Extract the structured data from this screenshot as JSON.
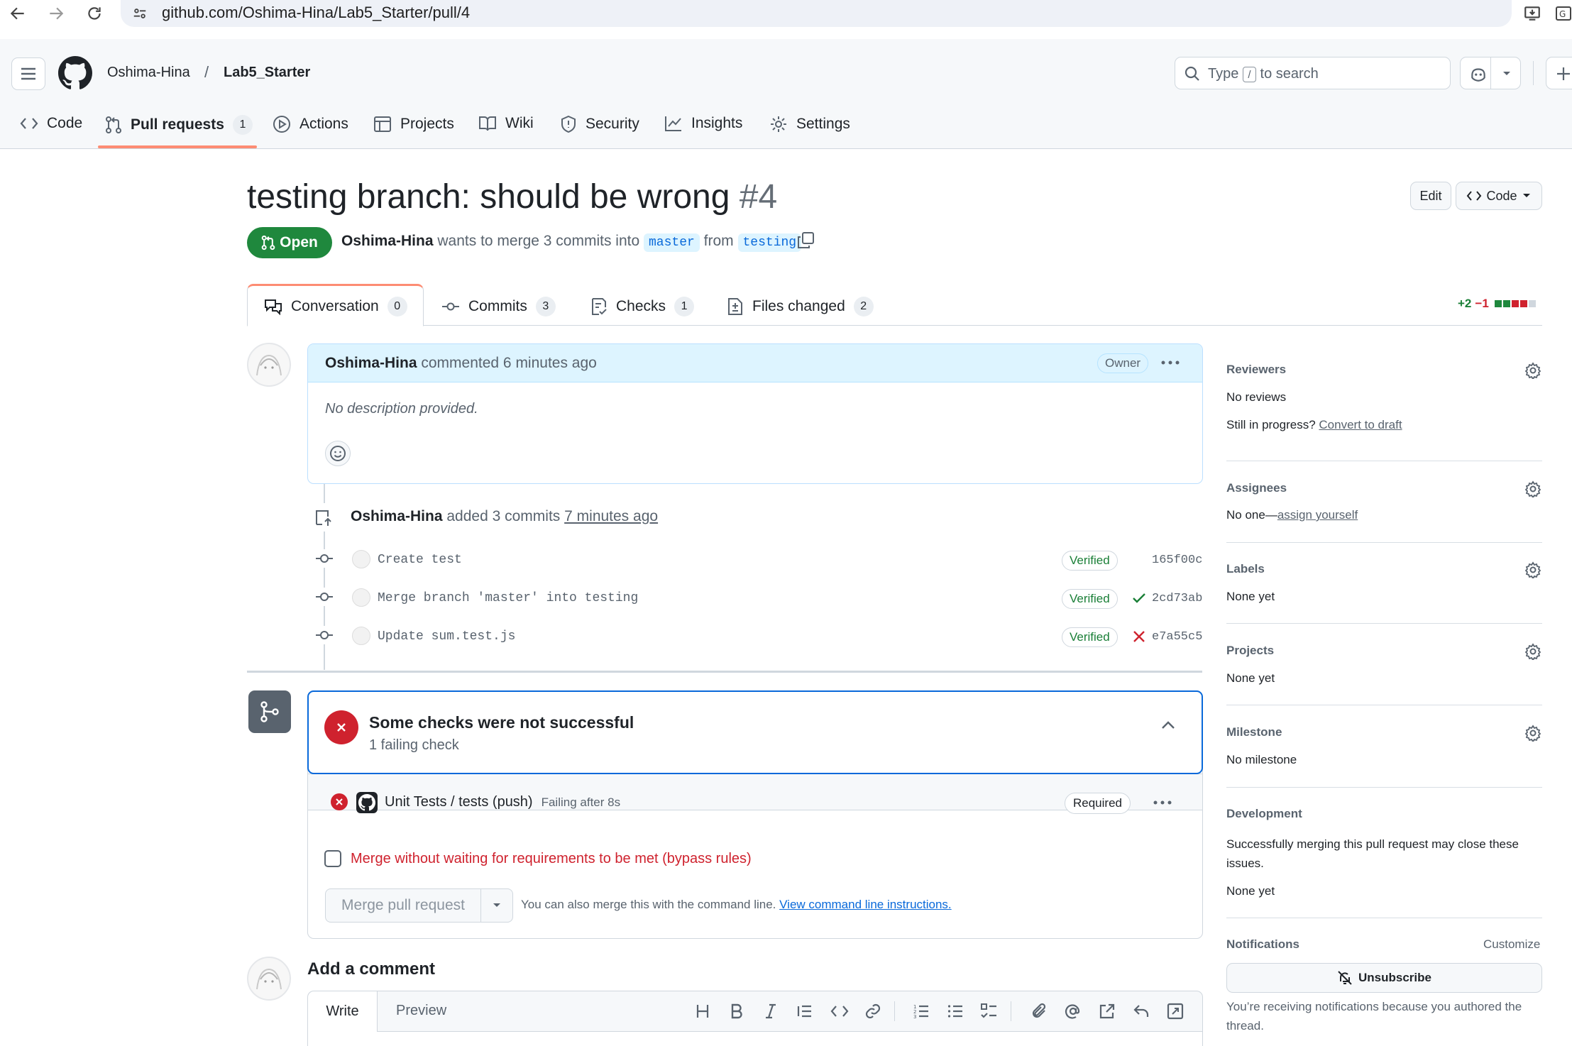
{
  "browser": {
    "url": "github.com/Oshima-Hina/Lab5_Starter/pull/4"
  },
  "header": {
    "owner": "Oshima-Hina",
    "separator": "/",
    "repo": "Lab5_Starter",
    "search_placeholder_prefix": "Type",
    "search_key": "/",
    "search_placeholder_suffix": "to search"
  },
  "repo_tabs": [
    {
      "label": "Code",
      "icon": "code-icon"
    },
    {
      "label": "Pull requests",
      "icon": "git-pull-request-icon",
      "count": "1",
      "active": true
    },
    {
      "label": "Actions",
      "icon": "play-icon"
    },
    {
      "label": "Projects",
      "icon": "table-icon"
    },
    {
      "label": "Wiki",
      "icon": "book-icon"
    },
    {
      "label": "Security",
      "icon": "shield-icon"
    },
    {
      "label": "Insights",
      "icon": "graph-icon"
    },
    {
      "label": "Settings",
      "icon": "gear-icon"
    }
  ],
  "pr": {
    "title": "testing branch: should be wrong",
    "number": "#4",
    "state": "Open",
    "author": "Oshima-Hina",
    "merge_text": "wants to merge 3 commits into",
    "base": "master",
    "from_text": "from",
    "head": "testing",
    "edit_label": "Edit",
    "code_label": "Code"
  },
  "pr_tabs": [
    {
      "label": "Conversation",
      "count": "0",
      "icon": "comment-discussion-icon"
    },
    {
      "label": "Commits",
      "count": "3",
      "icon": "git-commit-icon"
    },
    {
      "label": "Checks",
      "count": "1",
      "icon": "checklist-icon"
    },
    {
      "label": "Files changed",
      "count": "2",
      "icon": "file-diff-icon"
    }
  ],
  "diffstat": {
    "additions": "+2",
    "deletions": "−1"
  },
  "comment": {
    "author": "Oshima-Hina",
    "action": "commented 6 minutes ago",
    "role": "Owner",
    "body": "No description provided."
  },
  "commits_event": {
    "author": "Oshima-Hina",
    "action": "added 3 commits",
    "time": "7 minutes ago",
    "commits": [
      {
        "message": "Create test",
        "verified": "Verified",
        "sha": "165f00c",
        "status": ""
      },
      {
        "message": "Merge branch 'master' into testing",
        "verified": "Verified",
        "sha": "2cd73ab",
        "status": "success"
      },
      {
        "message": "Update sum.test.js",
        "verified": "Verified",
        "sha": "e7a55c5",
        "status": "failure"
      }
    ]
  },
  "checks": {
    "title": "Some checks were not successful",
    "subtitle": "1 failing check",
    "check_name": "Unit Tests / tests (push)",
    "check_status": "Failing after 8s",
    "required": "Required",
    "bypass_label": "Merge without waiting for requirements to be met (bypass rules)",
    "merge_button": "Merge pull request",
    "cli_text": "You can also merge this with the command line.",
    "cli_link": "View command line instructions."
  },
  "add_comment": {
    "title": "Add a comment",
    "write_tab": "Write",
    "preview_tab": "Preview"
  },
  "sidebar": {
    "reviewers": {
      "heading": "Reviewers",
      "value": "No reviews",
      "progress_text": "Still in progress?",
      "progress_link": "Convert to draft"
    },
    "assignees": {
      "heading": "Assignees",
      "value": "No one—",
      "link": "assign yourself"
    },
    "labels": {
      "heading": "Labels",
      "value": "None yet"
    },
    "projects": {
      "heading": "Projects",
      "value": "None yet"
    },
    "milestone": {
      "heading": "Milestone",
      "value": "No milestone"
    },
    "development": {
      "heading": "Development",
      "text": "Successfully merging this pull request may close these issues.",
      "value": "None yet"
    },
    "notifications": {
      "heading": "Notifications",
      "customize": "Customize",
      "button": "Unsubscribe",
      "note": "You’re receiving notifications because you authored the thread."
    }
  },
  "colors": {
    "success": "#1a7f37",
    "danger": "#cf222e",
    "accent": "#0969da",
    "open": "#1f883d",
    "tab_underline": "#fd8c73"
  }
}
